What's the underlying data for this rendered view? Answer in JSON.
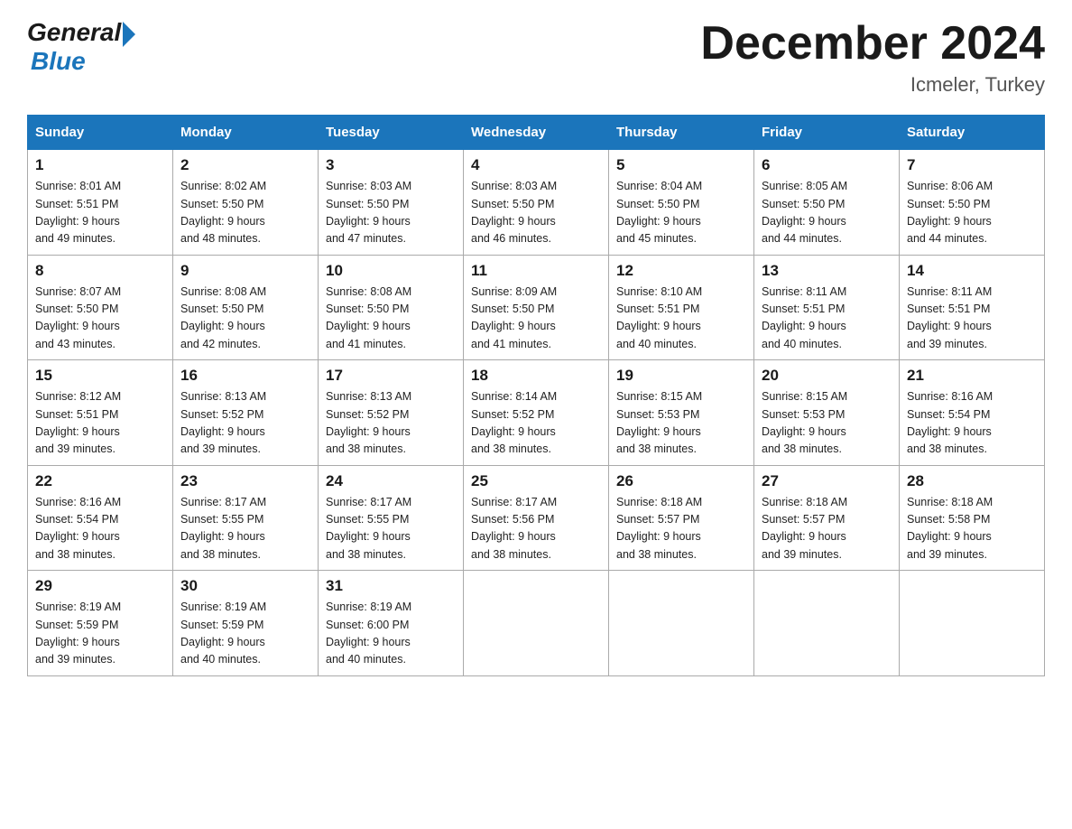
{
  "logo": {
    "general": "General",
    "blue": "Blue"
  },
  "title": "December 2024",
  "location": "Icmeler, Turkey",
  "weekdays": [
    "Sunday",
    "Monday",
    "Tuesday",
    "Wednesday",
    "Thursday",
    "Friday",
    "Saturday"
  ],
  "weeks": [
    [
      {
        "day": "1",
        "sunrise": "8:01 AM",
        "sunset": "5:51 PM",
        "daylight": "9 hours and 49 minutes."
      },
      {
        "day": "2",
        "sunrise": "8:02 AM",
        "sunset": "5:50 PM",
        "daylight": "9 hours and 48 minutes."
      },
      {
        "day": "3",
        "sunrise": "8:03 AM",
        "sunset": "5:50 PM",
        "daylight": "9 hours and 47 minutes."
      },
      {
        "day": "4",
        "sunrise": "8:03 AM",
        "sunset": "5:50 PM",
        "daylight": "9 hours and 46 minutes."
      },
      {
        "day": "5",
        "sunrise": "8:04 AM",
        "sunset": "5:50 PM",
        "daylight": "9 hours and 45 minutes."
      },
      {
        "day": "6",
        "sunrise": "8:05 AM",
        "sunset": "5:50 PM",
        "daylight": "9 hours and 44 minutes."
      },
      {
        "day": "7",
        "sunrise": "8:06 AM",
        "sunset": "5:50 PM",
        "daylight": "9 hours and 44 minutes."
      }
    ],
    [
      {
        "day": "8",
        "sunrise": "8:07 AM",
        "sunset": "5:50 PM",
        "daylight": "9 hours and 43 minutes."
      },
      {
        "day": "9",
        "sunrise": "8:08 AM",
        "sunset": "5:50 PM",
        "daylight": "9 hours and 42 minutes."
      },
      {
        "day": "10",
        "sunrise": "8:08 AM",
        "sunset": "5:50 PM",
        "daylight": "9 hours and 41 minutes."
      },
      {
        "day": "11",
        "sunrise": "8:09 AM",
        "sunset": "5:50 PM",
        "daylight": "9 hours and 41 minutes."
      },
      {
        "day": "12",
        "sunrise": "8:10 AM",
        "sunset": "5:51 PM",
        "daylight": "9 hours and 40 minutes."
      },
      {
        "day": "13",
        "sunrise": "8:11 AM",
        "sunset": "5:51 PM",
        "daylight": "9 hours and 40 minutes."
      },
      {
        "day": "14",
        "sunrise": "8:11 AM",
        "sunset": "5:51 PM",
        "daylight": "9 hours and 39 minutes."
      }
    ],
    [
      {
        "day": "15",
        "sunrise": "8:12 AM",
        "sunset": "5:51 PM",
        "daylight": "9 hours and 39 minutes."
      },
      {
        "day": "16",
        "sunrise": "8:13 AM",
        "sunset": "5:52 PM",
        "daylight": "9 hours and 39 minutes."
      },
      {
        "day": "17",
        "sunrise": "8:13 AM",
        "sunset": "5:52 PM",
        "daylight": "9 hours and 38 minutes."
      },
      {
        "day": "18",
        "sunrise": "8:14 AM",
        "sunset": "5:52 PM",
        "daylight": "9 hours and 38 minutes."
      },
      {
        "day": "19",
        "sunrise": "8:15 AM",
        "sunset": "5:53 PM",
        "daylight": "9 hours and 38 minutes."
      },
      {
        "day": "20",
        "sunrise": "8:15 AM",
        "sunset": "5:53 PM",
        "daylight": "9 hours and 38 minutes."
      },
      {
        "day": "21",
        "sunrise": "8:16 AM",
        "sunset": "5:54 PM",
        "daylight": "9 hours and 38 minutes."
      }
    ],
    [
      {
        "day": "22",
        "sunrise": "8:16 AM",
        "sunset": "5:54 PM",
        "daylight": "9 hours and 38 minutes."
      },
      {
        "day": "23",
        "sunrise": "8:17 AM",
        "sunset": "5:55 PM",
        "daylight": "9 hours and 38 minutes."
      },
      {
        "day": "24",
        "sunrise": "8:17 AM",
        "sunset": "5:55 PM",
        "daylight": "9 hours and 38 minutes."
      },
      {
        "day": "25",
        "sunrise": "8:17 AM",
        "sunset": "5:56 PM",
        "daylight": "9 hours and 38 minutes."
      },
      {
        "day": "26",
        "sunrise": "8:18 AM",
        "sunset": "5:57 PM",
        "daylight": "9 hours and 38 minutes."
      },
      {
        "day": "27",
        "sunrise": "8:18 AM",
        "sunset": "5:57 PM",
        "daylight": "9 hours and 39 minutes."
      },
      {
        "day": "28",
        "sunrise": "8:18 AM",
        "sunset": "5:58 PM",
        "daylight": "9 hours and 39 minutes."
      }
    ],
    [
      {
        "day": "29",
        "sunrise": "8:19 AM",
        "sunset": "5:59 PM",
        "daylight": "9 hours and 39 minutes."
      },
      {
        "day": "30",
        "sunrise": "8:19 AM",
        "sunset": "5:59 PM",
        "daylight": "9 hours and 40 minutes."
      },
      {
        "day": "31",
        "sunrise": "8:19 AM",
        "sunset": "6:00 PM",
        "daylight": "9 hours and 40 minutes."
      },
      null,
      null,
      null,
      null
    ]
  ]
}
